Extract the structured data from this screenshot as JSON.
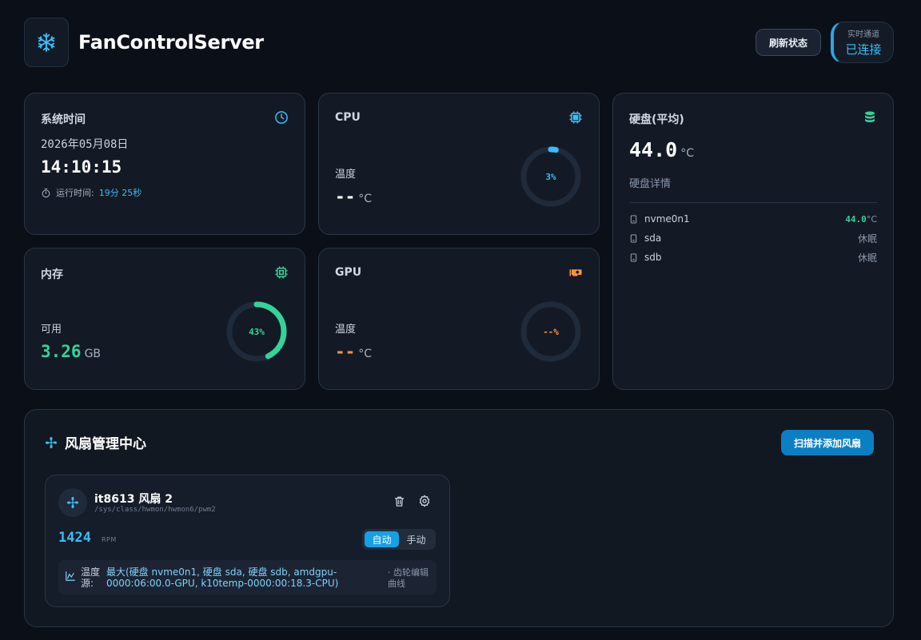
{
  "header": {
    "title": "FanControlServer",
    "refresh_label": "刷新状态",
    "connection_label": "实时通道",
    "connection_status": "已连接"
  },
  "system_time": {
    "title": "系统时间",
    "date": "2026年05月08日",
    "time": "14:10:15",
    "uptime_label": "运行时间:",
    "uptime_value": "19分 25秒"
  },
  "cpu": {
    "title": "CPU",
    "temp_label": "温度",
    "temp_value": "--",
    "temp_unit": "°C",
    "usage_percent": 3,
    "usage_text": "3%",
    "color": "#38bdf8"
  },
  "disk": {
    "title": "硬盘(平均)",
    "avg_temp": "44.0",
    "unit": "°C",
    "details_label": "硬盘详情",
    "disks": [
      {
        "name": "nvme0n1",
        "status": "44.0",
        "unit": "°C"
      },
      {
        "name": "sda",
        "status": "休眠",
        "unit": ""
      },
      {
        "name": "sdb",
        "status": "休眠",
        "unit": ""
      }
    ],
    "color": "#34d399"
  },
  "memory": {
    "title": "内存",
    "avail_label": "可用",
    "avail_value": "3.26",
    "avail_unit": "GB",
    "usage_percent": 43,
    "usage_text": "43%",
    "color": "#34d399"
  },
  "gpu": {
    "title": "GPU",
    "temp_label": "温度",
    "temp_value": "--",
    "temp_unit": "°C",
    "usage_text": "--%",
    "color": "#fb923c"
  },
  "fans": {
    "title": "风扇管理中心",
    "scan_label": "扫描并添加风扇",
    "items": [
      {
        "name": "it8613 风扇 2",
        "path": "/sys/class/hwmon/hwmon6/pwm2",
        "rpm": "1424",
        "rpm_unit": "RPM",
        "mode_auto": "自动",
        "mode_manual": "手动",
        "source_label": "温度源:",
        "source_text": "最大(硬盘 nvme0n1, 硬盘 sda, 硬盘 sdb, amdgpu-0000:06:00.0-GPU, k10temp-0000:00:18.3-CPU)",
        "curve_link": "· 齿轮编辑曲线"
      }
    ]
  }
}
